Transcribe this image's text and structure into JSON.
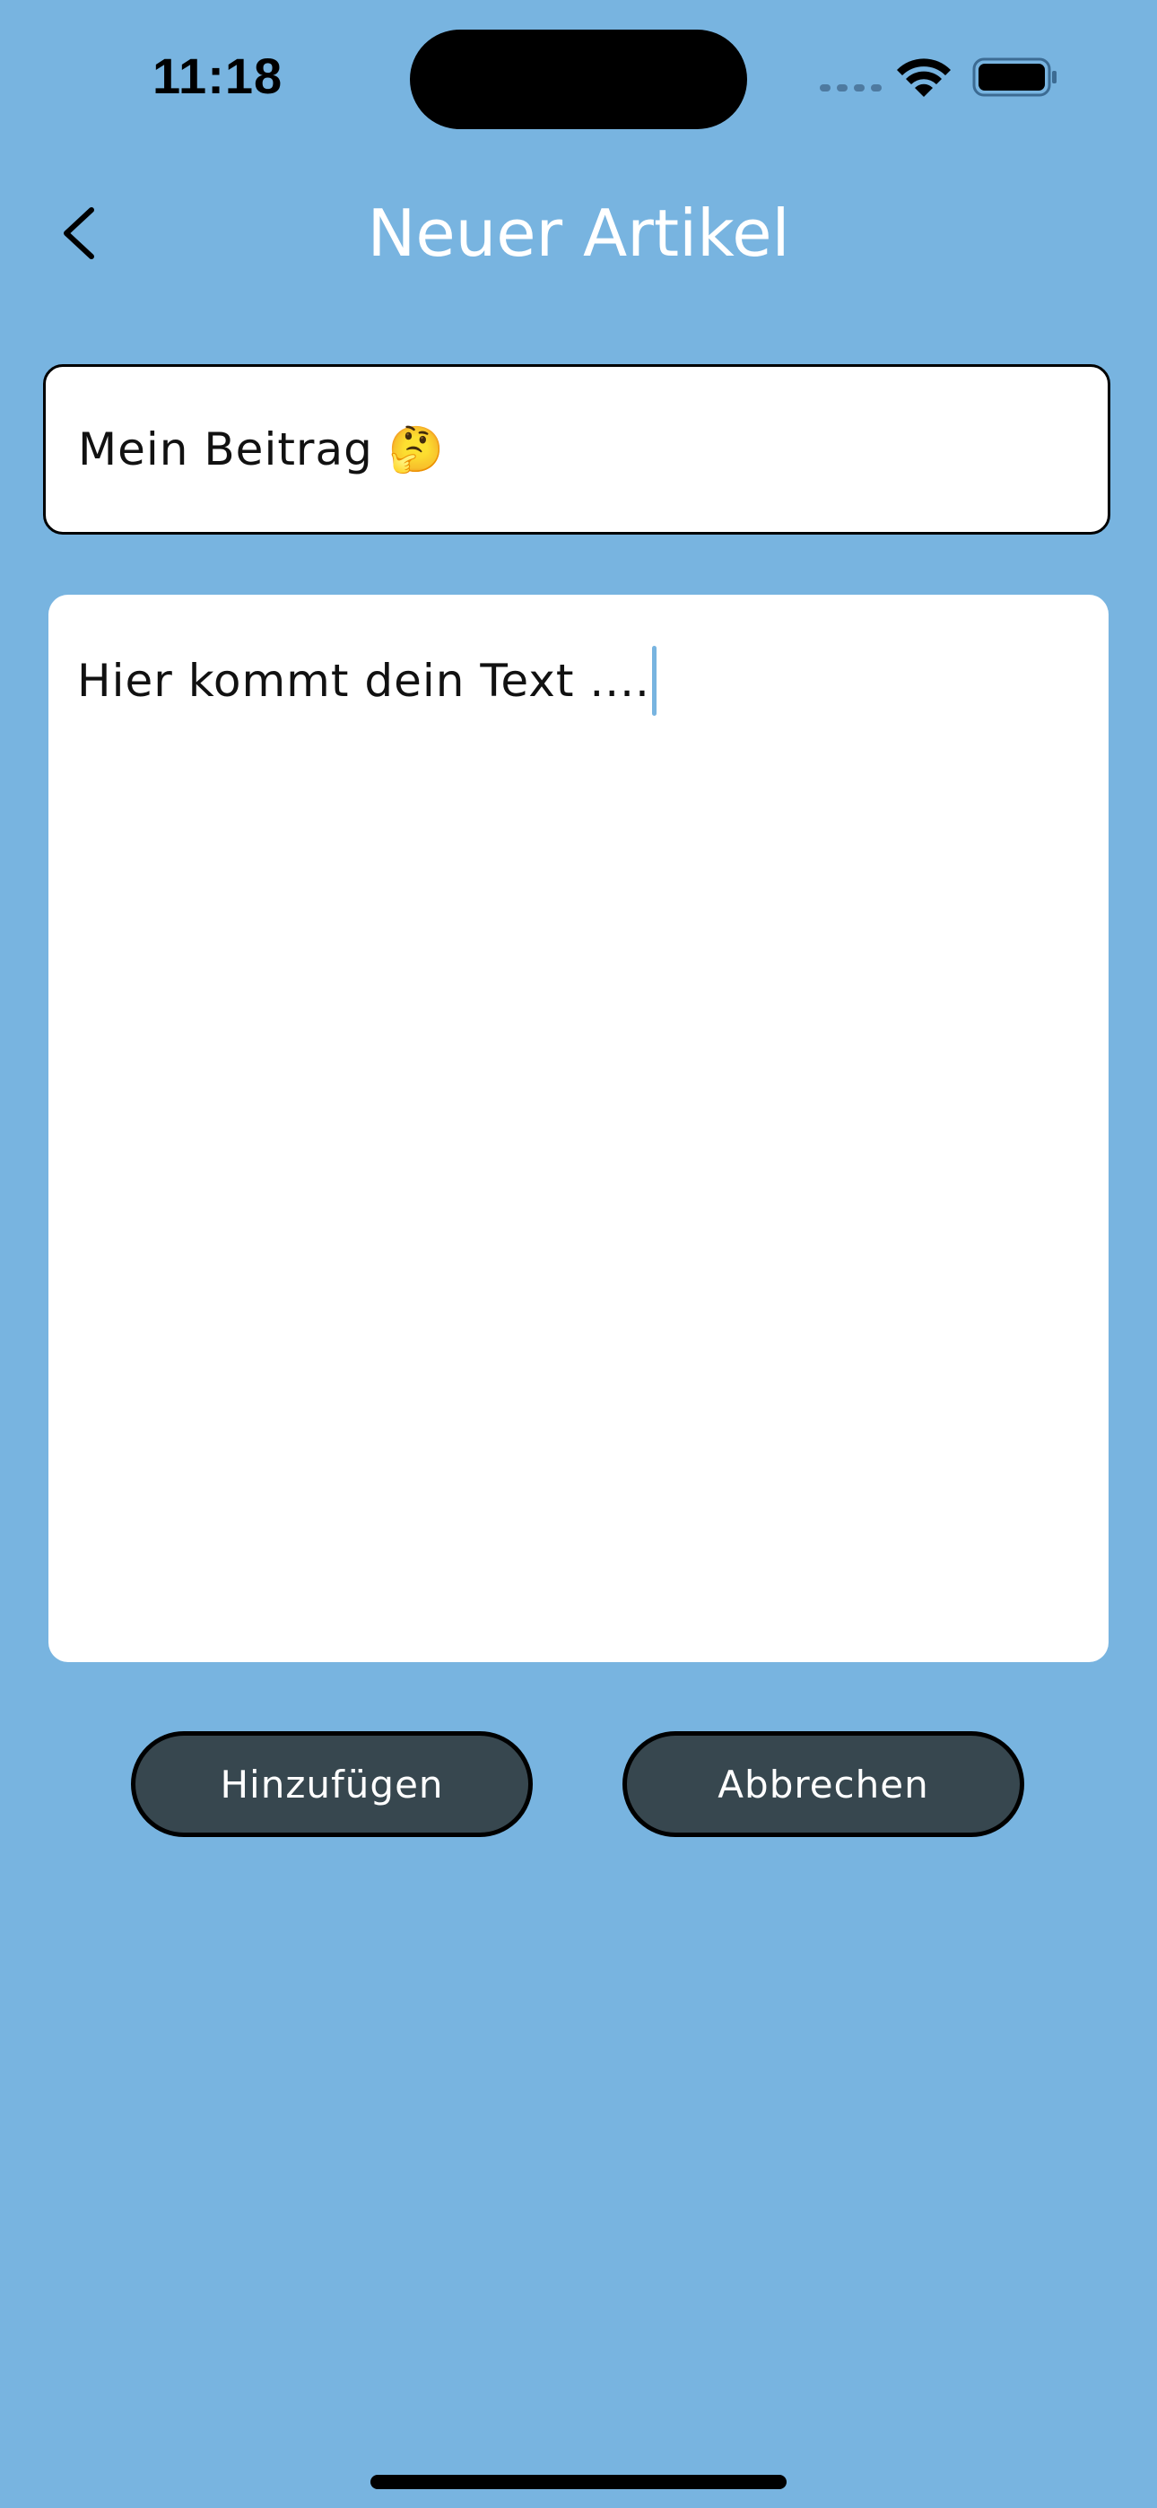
{
  "status_bar": {
    "time": "11:18",
    "icons": [
      "cellular-signal-icon",
      "wifi-icon",
      "battery-icon"
    ]
  },
  "nav": {
    "back_icon": "chevron-left-icon",
    "title": "Neuer Artikel"
  },
  "form": {
    "title_value": "Mein Beitrag 🤔",
    "body_value": "Hier kommt dein Text ...."
  },
  "actions": {
    "add_label": "Hinzufügen",
    "cancel_label": "Abbrechen"
  },
  "colors": {
    "background": "#78b4e0",
    "button_fill": "#37474f",
    "caret": "#78b4e0"
  }
}
